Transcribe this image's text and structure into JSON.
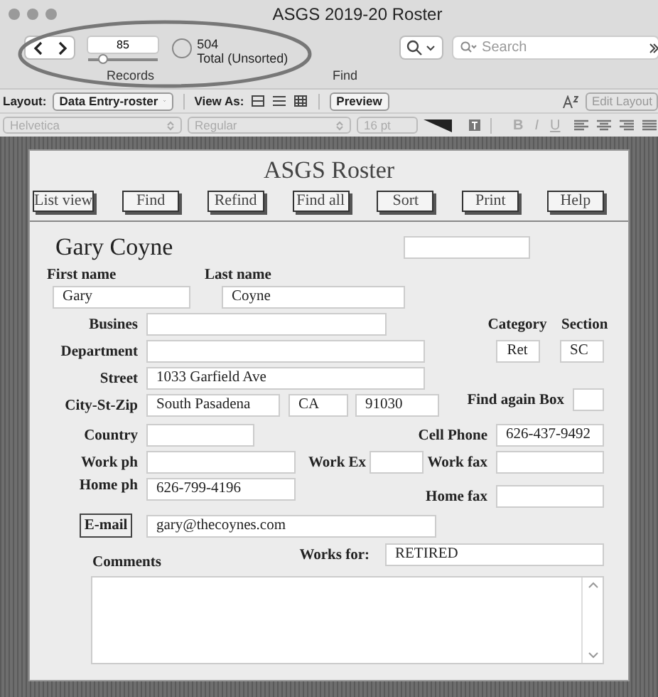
{
  "window": {
    "title": "ASGS 2019-20 Roster"
  },
  "toolbar": {
    "record_number": "85",
    "record_slider": {
      "level": 0.2
    },
    "total": "504",
    "total_label": "Total (Unsorted)",
    "records_label": "Records",
    "find_label": "Find",
    "search_placeholder": "Search"
  },
  "layout_bar": {
    "layout_label": "Layout:",
    "layout_value": "Data Entry-roster",
    "view_as_label": "View As:",
    "preview_button": "Preview",
    "edit_layout_button": "Edit Layout"
  },
  "format_bar": {
    "disabled": true,
    "font": "Helvetica",
    "style": "Regular",
    "size": "16 pt",
    "bold": "B",
    "italic": "I",
    "underline": "U"
  },
  "form": {
    "title": "ASGS Roster",
    "buttons": [
      "List view",
      "Find",
      "Refind",
      "Find all",
      "Sort",
      "Print",
      "Help"
    ],
    "name_heading": "Gary Coyne",
    "first_name": {
      "label": "First name",
      "value": "Gary"
    },
    "last_name": {
      "label": "Last name",
      "value": "Coyne"
    },
    "business": {
      "label": "Busines"
    },
    "category": {
      "label": "Category",
      "value": "Ret"
    },
    "section": {
      "label": "Section",
      "value": "SC"
    },
    "department": {
      "label": "Department"
    },
    "street": {
      "label": "Street",
      "value": "1033 Garfield Ave"
    },
    "city_st_zip": {
      "label": "City-St-Zip",
      "city": "South Pasadena",
      "state": "CA",
      "zip": "91030"
    },
    "find_again_box": {
      "label": "Find again Box"
    },
    "country": {
      "label": "Country"
    },
    "cell_phone": {
      "label": "Cell Phone",
      "value": "626-437-9492"
    },
    "work_ph": {
      "label": "Work ph"
    },
    "work_ex": {
      "label": "Work Ex"
    },
    "work_fax": {
      "label": "Work fax"
    },
    "home_ph": {
      "label": "Home ph",
      "value": "626-799-4196"
    },
    "home_fax": {
      "label": "Home fax"
    },
    "email": {
      "button": "E-mail",
      "value": "gary@thecoynes.com"
    },
    "works_for": {
      "label": "Works for:",
      "value": "RETIRED"
    },
    "comments": {
      "label": "Comments"
    }
  }
}
